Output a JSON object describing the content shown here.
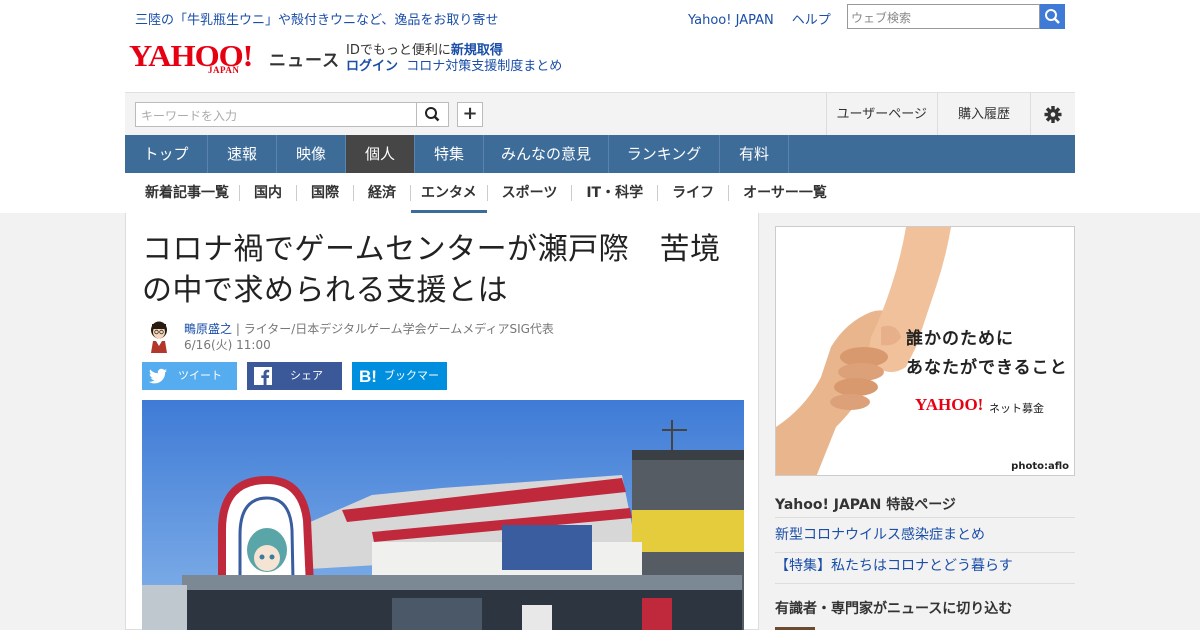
{
  "promo": {
    "text": "三陸の「牛乳瓶生ウニ」や殻付きウニなど、逸品をお取り寄せ"
  },
  "top_links": [
    "Yahoo! JAPAN",
    "ヘルプ"
  ],
  "web_search": {
    "placeholder": "ウェブ検索"
  },
  "logo": {
    "yahoo": "YAHOO!",
    "japan": "JAPAN",
    "news": "ニュース"
  },
  "id_area": {
    "line1_prefix": "IDでもっと便利に",
    "line1_link": "新規取得",
    "login": "ログイン",
    "corona_link": "コロナ対策支援制度まとめ"
  },
  "keyword_search": {
    "placeholder": "キーワードを入力"
  },
  "header_right": {
    "user_page": "ユーザーページ",
    "purchase_history": "購入履歴"
  },
  "main_nav": [
    {
      "label": "トップ",
      "active": false
    },
    {
      "label": "速報",
      "active": false
    },
    {
      "label": "映像",
      "active": false
    },
    {
      "label": "個人",
      "active": true
    },
    {
      "label": "特集",
      "active": false
    },
    {
      "label": "みんなの意見",
      "active": false
    },
    {
      "label": "ランキング",
      "active": false
    },
    {
      "label": "有料",
      "active": false
    }
  ],
  "sub_nav": [
    {
      "label": "新着記事一覧",
      "selected": false
    },
    {
      "label": "国内",
      "selected": false
    },
    {
      "label": "国際",
      "selected": false
    },
    {
      "label": "経済",
      "selected": false
    },
    {
      "label": "エンタメ",
      "selected": true
    },
    {
      "label": "スポーツ",
      "selected": false
    },
    {
      "label": "IT・科学",
      "selected": false
    },
    {
      "label": "ライフ",
      "selected": false
    },
    {
      "label": "オーサー一覧",
      "selected": false
    }
  ],
  "article": {
    "title_line1": "コロナ禍でゲームセンターが瀬戸際　苦境",
    "title_line2": "の中で求められる支援とは",
    "author_name": "鴫原盛之",
    "author_desc": " | ライター/日本デジタルゲーム学会ゲームメディアSIG代表",
    "date": "6/16(火) 11:00"
  },
  "share_buttons": {
    "tweet": "ツイート",
    "share": "シェア",
    "bookmark": "ブックマーク"
  },
  "ad": {
    "line1": "誰かのために",
    "line2": "あなたができること",
    "logo_text": "YAHOO!",
    "logo_sub": "ネット募金",
    "credit": "photo:aflo"
  },
  "sidebar": {
    "special_heading": "Yahoo! JAPAN 特設ページ",
    "special_links": [
      "新型コロナウイルス感染症まとめ",
      "【特集】私たちはコロナとどう暮らす"
    ],
    "experts_heading": "有識者・専門家がニュースに切り込む"
  },
  "colors": {
    "nav_bg": "#3d6c99",
    "nav_active": "#464646",
    "link": "#1a4ea8",
    "yahoo_red": "#e60012",
    "twitter": "#55acee",
    "facebook": "#3b5998",
    "hatena": "#008fde"
  }
}
